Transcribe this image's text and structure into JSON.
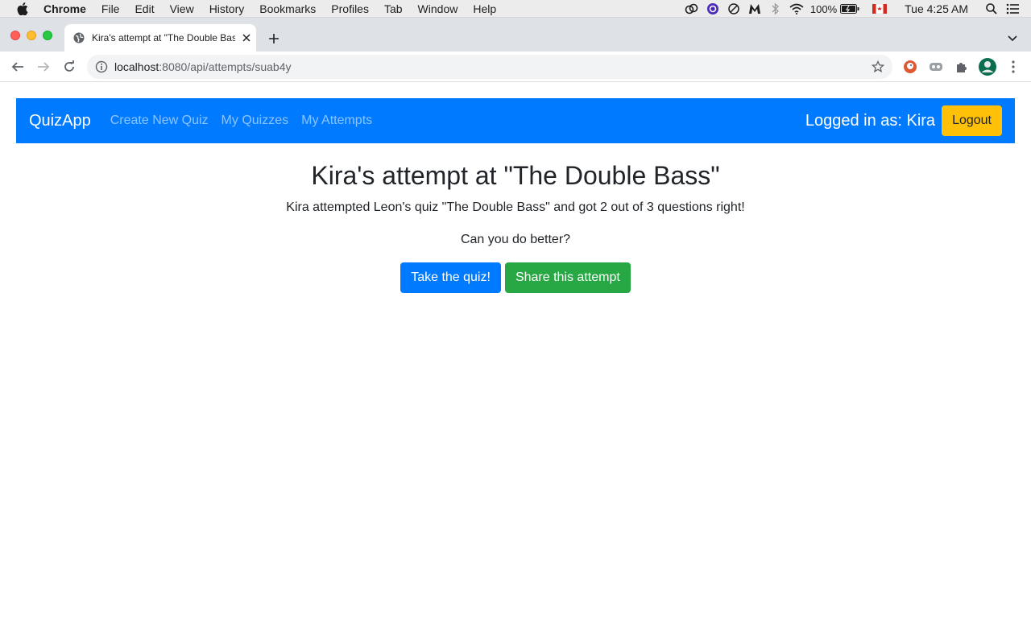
{
  "menubar": {
    "app_name": "Chrome",
    "items": [
      "File",
      "Edit",
      "View",
      "History",
      "Bookmarks",
      "Profiles",
      "Tab",
      "Window",
      "Help"
    ],
    "battery": "100%",
    "clock": "Tue 4:25 AM"
  },
  "browser": {
    "tab_title": "Kira's attempt at \"The Double Bass\"",
    "url_host": "localhost",
    "url_rest": ":8080/api/attempts/suab4y"
  },
  "navbar": {
    "brand": "QuizApp",
    "links": [
      "Create New Quiz",
      "My Quizzes",
      "My Attempts"
    ],
    "user_text": "Logged in as: Kira",
    "logout_label": "Logout"
  },
  "main": {
    "heading": "Kira's attempt at \"The Double Bass\"",
    "summary": "Kira attempted Leon's quiz \"The Double Bass\" and got 2 out of 3 questions right!",
    "prompt": "Can you do better?",
    "take_quiz_label": "Take the quiz!",
    "share_label": "Share this attempt"
  },
  "colors": {
    "navbar": "#007bff",
    "logout": "#ffc107",
    "take_quiz": "#007bff",
    "share": "#28a745"
  }
}
